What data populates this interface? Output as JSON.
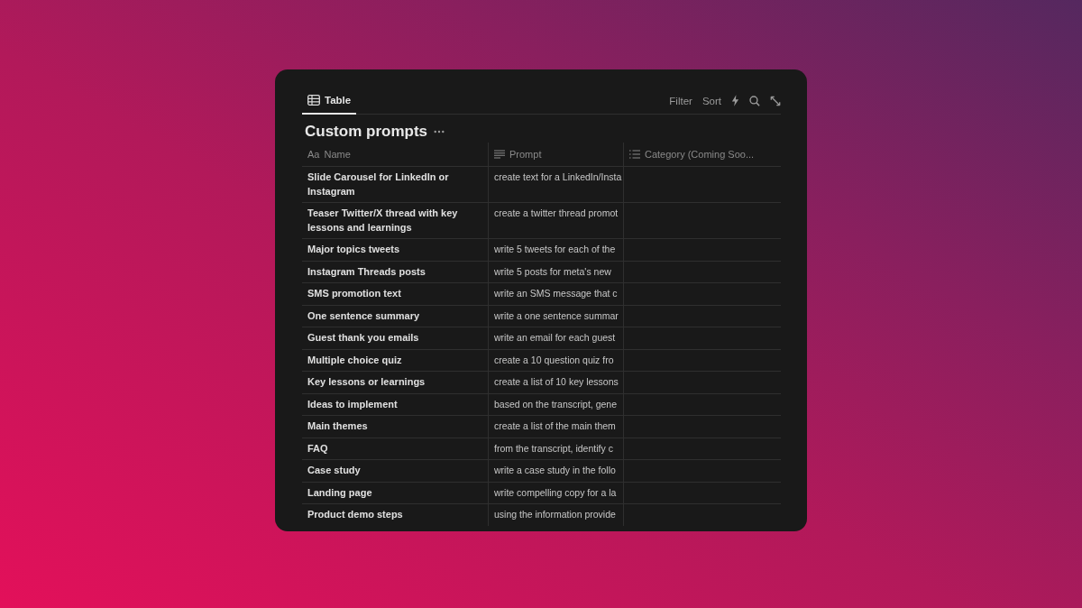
{
  "tabs": [
    {
      "label": "Table",
      "selected": true
    }
  ],
  "toolbar": {
    "filter": "Filter",
    "sort": "Sort"
  },
  "title": "Custom prompts",
  "columns": [
    {
      "kind": "title",
      "icon_text": "Aa",
      "label": "Name"
    },
    {
      "kind": "text",
      "label": "Prompt"
    },
    {
      "kind": "list",
      "label": "Category (Coming Soo..."
    }
  ],
  "rows": [
    {
      "name": "Slide Carousel for LinkedIn or Instagram",
      "prompt": "create text for a LinkedIn/Insta"
    },
    {
      "name": "Teaser Twitter/X thread with key lessons and learnings",
      "prompt": "create a twitter thread promot"
    },
    {
      "name": "Major topics tweets",
      "prompt": "write 5 tweets for each of the"
    },
    {
      "name": "Instagram Threads posts",
      "prompt": "write 5 posts for meta's new"
    },
    {
      "name": "SMS promotion text",
      "prompt": "write an SMS message that c"
    },
    {
      "name": "One sentence summary",
      "prompt": "write a one sentence summar"
    },
    {
      "name": "Guest thank you emails",
      "prompt": "write an email for each guest"
    },
    {
      "name": "Multiple choice quiz",
      "prompt": "create a 10 question quiz fro"
    },
    {
      "name": "Key lessons or learnings",
      "prompt": "create a list of 10 key lessons"
    },
    {
      "name": "Ideas to implement",
      "prompt": "based on the transcript, gene"
    },
    {
      "name": "Main themes",
      "prompt": "create a list of the main them"
    },
    {
      "name": "FAQ",
      "prompt": "from the transcript, identify c"
    },
    {
      "name": "Case study",
      "prompt": "write a case study in the follo"
    },
    {
      "name": "Landing page",
      "prompt": "write compelling copy for a la"
    },
    {
      "name": "Product demo steps",
      "prompt": "using the information provide"
    }
  ]
}
